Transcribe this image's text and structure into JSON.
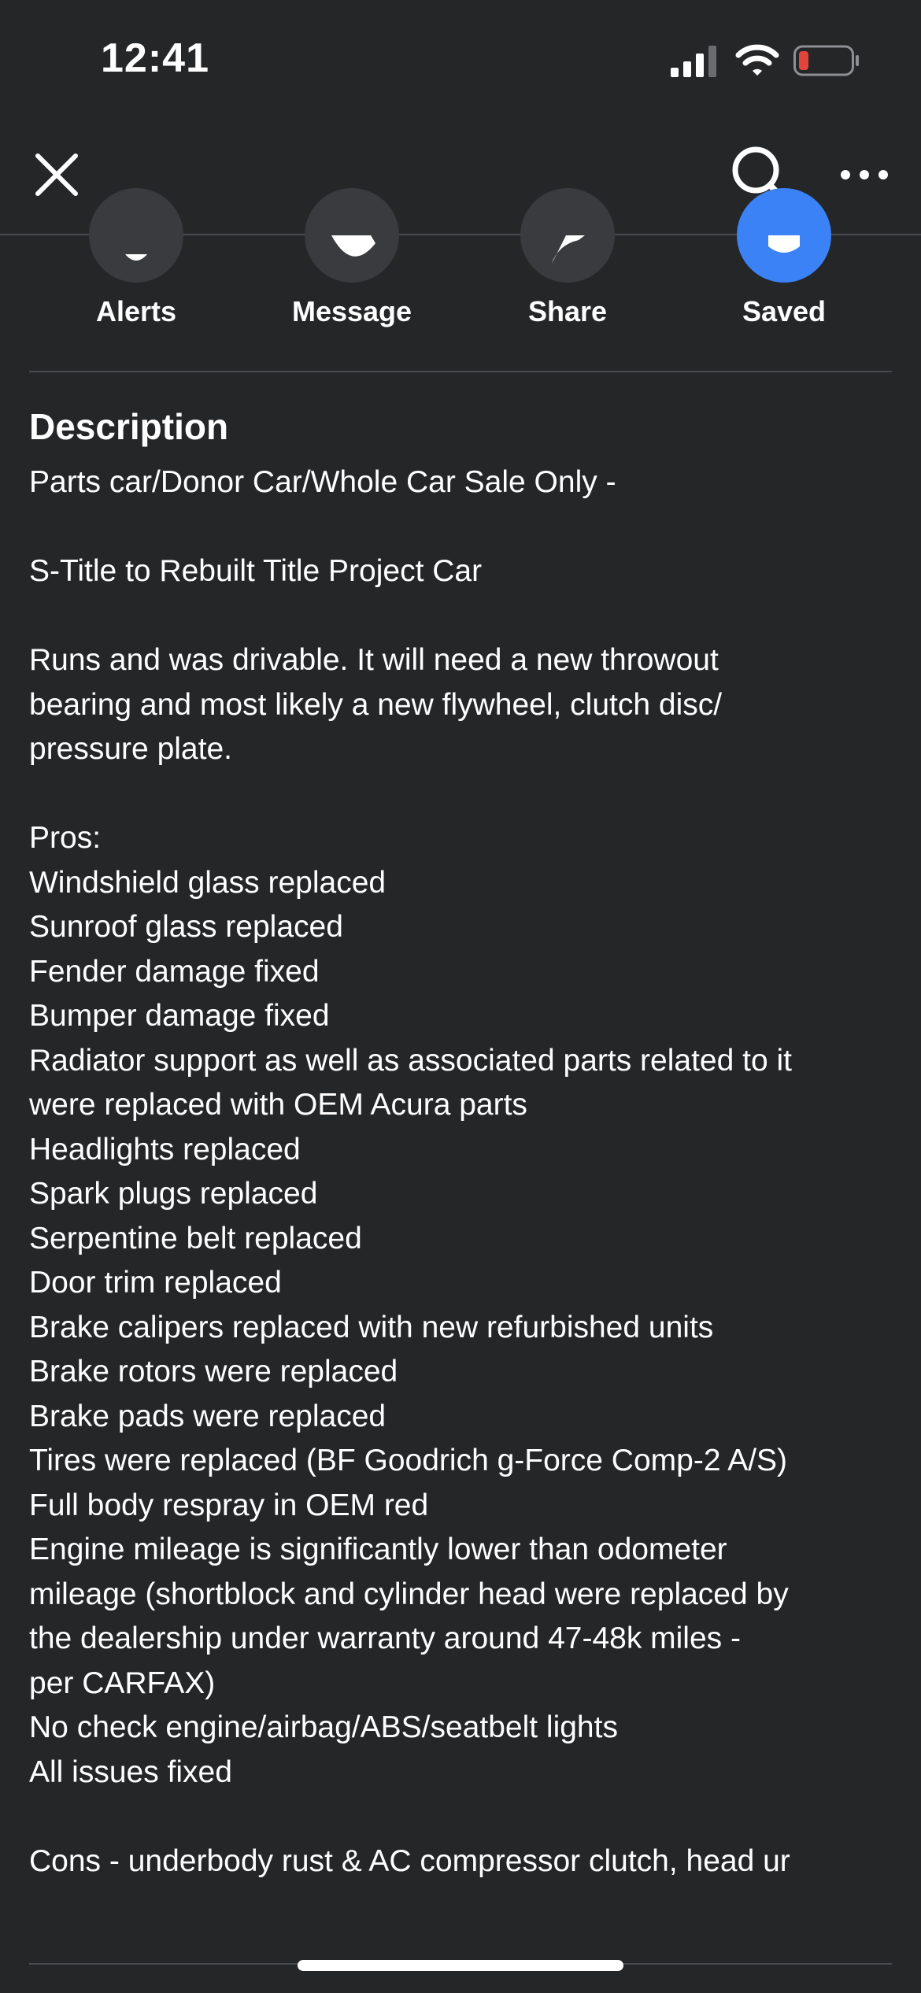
{
  "status_bar": {
    "time": "12:41",
    "battery_color": "#e0443a"
  },
  "nav": {
    "close_icon": "close-icon",
    "search_icon": "search-icon",
    "more_icon": "more-horizontal-icon"
  },
  "actions": [
    {
      "label": "Alerts",
      "icon": "bell-icon"
    },
    {
      "label": "Message",
      "icon": "messenger-icon"
    },
    {
      "label": "Share",
      "icon": "share-icon"
    },
    {
      "label": "Saved",
      "icon": "bookmark-icon",
      "accent": "#3b82f6"
    }
  ],
  "description": {
    "title": "Description",
    "lines": [
      "Parts car/Donor Car/Whole Car Sale Only -",
      "",
      "S-Title to Rebuilt Title Project Car",
      "",
      "Runs and was drivable. It will need a new throwout",
      "bearing and most likely a new flywheel, clutch disc/",
      "pressure plate.",
      "",
      "Pros:",
      "Windshield glass replaced",
      "Sunroof glass replaced",
      "Fender damage fixed",
      "Bumper damage fixed",
      "Radiator support as well as associated parts related to it",
      "were replaced with OEM Acura parts",
      "Headlights replaced",
      "Spark plugs replaced",
      "Serpentine belt replaced",
      "Door trim replaced",
      "Brake calipers replaced with new refurbished units",
      "Brake rotors were replaced",
      "Brake pads were replaced",
      "Tires were replaced (BF Goodrich g-Force Comp-2 A/S)",
      "Full body respray in OEM red",
      "Engine mileage is significantly lower than odometer",
      "mileage (shortblock and cylinder head were replaced by",
      "the dealership under warranty around 47-48k miles -",
      "per CARFAX)",
      "No check engine/airbag/ABS/seatbelt lights",
      "All issues fixed",
      "",
      "Cons - underbody rust & AC compressor clutch, head ur"
    ]
  }
}
